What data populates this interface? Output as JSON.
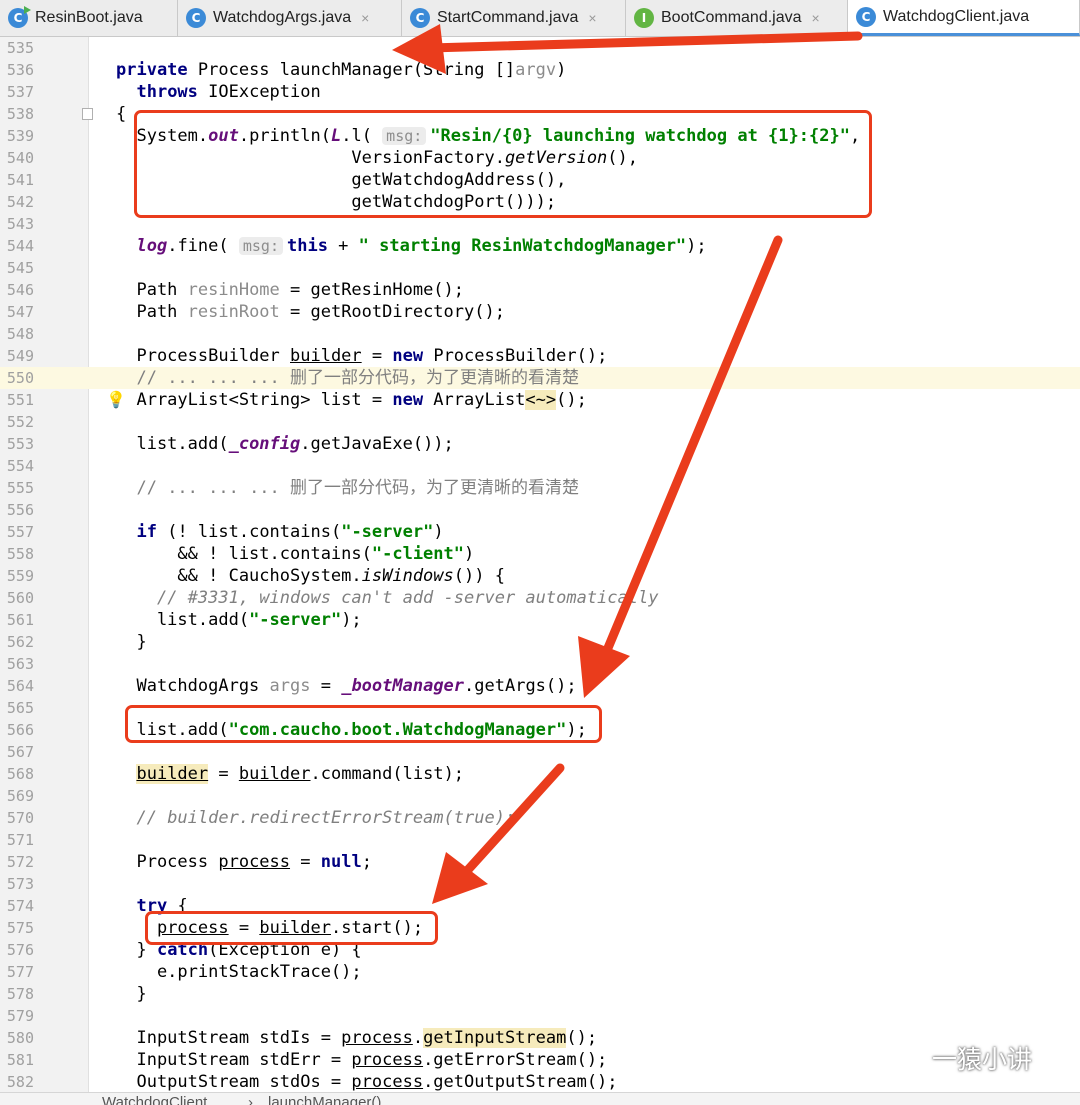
{
  "tabs": [
    {
      "label": "ResinBoot.java",
      "icon": "run-class-icon",
      "close": "×"
    },
    {
      "label": "WatchdogArgs.java",
      "icon": "class-icon",
      "close": "×"
    },
    {
      "label": "StartCommand.java",
      "icon": "class-icon",
      "close": "×"
    },
    {
      "label": "BootCommand.java",
      "icon": "interface-icon",
      "close": "×"
    },
    {
      "label": "WatchdogClient.java",
      "icon": "class-icon",
      "close": "×"
    }
  ],
  "tab_icon_glyphs": {
    "class": "C",
    "interface": "I"
  },
  "editor": {
    "caret_line": "550",
    "lines": [
      {
        "n": "535",
        "t": []
      },
      {
        "n": "536",
        "t": [
          [
            "kw",
            "private "
          ],
          [
            "",
            "Process launchManager(String []"
          ],
          [
            "grey",
            "argv"
          ],
          [
            "",
            ")"
          ]
        ]
      },
      {
        "n": "537",
        "t": [
          [
            "",
            "  "
          ],
          [
            "kw",
            "throws "
          ],
          [
            "",
            "IOException"
          ]
        ]
      },
      {
        "n": "538",
        "t": [
          [
            "",
            "{"
          ]
        ]
      },
      {
        "n": "539",
        "t": [
          [
            "",
            "  System."
          ],
          [
            "fld",
            "out"
          ],
          [
            "",
            ".println("
          ],
          [
            "fld",
            "L"
          ],
          [
            "",
            ".l( "
          ],
          [
            "hint",
            "msg:"
          ],
          [
            "str",
            "\"Resin/{0} launching watchdog at {1}:{2}\""
          ],
          [
            "",
            ","
          ]
        ]
      },
      {
        "n": "540",
        "t": [
          [
            "",
            "                       VersionFactory."
          ],
          [
            "sfn",
            "getVersion"
          ],
          [
            "",
            "(),"
          ]
        ]
      },
      {
        "n": "541",
        "t": [
          [
            "",
            "                       getWatchdogAddress(),"
          ]
        ]
      },
      {
        "n": "542",
        "t": [
          [
            "",
            "                       getWatchdogPort()));"
          ]
        ]
      },
      {
        "n": "543",
        "t": []
      },
      {
        "n": "544",
        "t": [
          [
            "",
            "  "
          ],
          [
            "fld",
            "log"
          ],
          [
            "",
            ".fine( "
          ],
          [
            "hint",
            "msg:"
          ],
          [
            "kw",
            "this"
          ],
          [
            "",
            " + "
          ],
          [
            "str",
            "\" starting ResinWatchdogManager\""
          ],
          [
            "",
            ");"
          ]
        ]
      },
      {
        "n": "545",
        "t": []
      },
      {
        "n": "546",
        "t": [
          [
            "",
            "  Path "
          ],
          [
            "grey",
            "resinHome"
          ],
          [
            "",
            " = getResinHome();"
          ]
        ]
      },
      {
        "n": "547",
        "t": [
          [
            "",
            "  Path "
          ],
          [
            "grey",
            "resinRoot"
          ],
          [
            "",
            " = getRootDirectory();"
          ]
        ]
      },
      {
        "n": "548",
        "t": []
      },
      {
        "n": "549",
        "t": [
          [
            "",
            "  ProcessBuilder "
          ],
          [
            "ul",
            "builder"
          ],
          [
            "",
            " = "
          ],
          [
            "kw",
            "new "
          ],
          [
            "",
            "ProcessBuilder();"
          ]
        ]
      },
      {
        "n": "550",
        "t": [
          [
            "",
            "  "
          ],
          [
            "cmcn",
            "// ... ... ... 删了一部分代码，为了更清晰的看清楚"
          ]
        ]
      },
      {
        "n": "551",
        "t": [
          [
            "",
            "  ArrayList<String> list = "
          ],
          [
            "kw",
            "new "
          ],
          [
            "",
            "ArrayList"
          ],
          [
            "hl",
            "<~>"
          ],
          [
            "",
            "();"
          ]
        ]
      },
      {
        "n": "552",
        "t": []
      },
      {
        "n": "553",
        "t": [
          [
            "",
            "  list.add("
          ],
          [
            "fld",
            "_config"
          ],
          [
            "",
            ".getJavaExe());"
          ]
        ]
      },
      {
        "n": "554",
        "t": []
      },
      {
        "n": "555",
        "t": [
          [
            "",
            "  "
          ],
          [
            "cmcn",
            "// ... ... ... 删了一部分代码，为了更清晰的看清楚"
          ]
        ]
      },
      {
        "n": "556",
        "t": []
      },
      {
        "n": "557",
        "t": [
          [
            "",
            "  "
          ],
          [
            "kw",
            "if "
          ],
          [
            "",
            "(! list.contains("
          ],
          [
            "str",
            "\"-server\""
          ],
          [
            "",
            ")"
          ]
        ]
      },
      {
        "n": "558",
        "t": [
          [
            "",
            "      && ! list.contains("
          ],
          [
            "str",
            "\"-client\""
          ],
          [
            "",
            ")"
          ]
        ]
      },
      {
        "n": "559",
        "t": [
          [
            "",
            "      && ! CauchoSystem."
          ],
          [
            "sfn",
            "isWindows"
          ],
          [
            "",
            "()) {"
          ]
        ]
      },
      {
        "n": "560",
        "t": [
          [
            "",
            "    "
          ],
          [
            "cm",
            "// #3331, windows can't add -server automatically"
          ]
        ]
      },
      {
        "n": "561",
        "t": [
          [
            "",
            "    list.add("
          ],
          [
            "str",
            "\"-server\""
          ],
          [
            "",
            ");"
          ]
        ]
      },
      {
        "n": "562",
        "t": [
          [
            "",
            "  }"
          ]
        ]
      },
      {
        "n": "563",
        "t": []
      },
      {
        "n": "564",
        "t": [
          [
            "",
            "  WatchdogArgs "
          ],
          [
            "grey",
            "args"
          ],
          [
            "",
            " = "
          ],
          [
            "fld",
            "_bootManager"
          ],
          [
            "",
            ".getArgs();"
          ]
        ]
      },
      {
        "n": "565",
        "t": []
      },
      {
        "n": "566",
        "t": [
          [
            "",
            "  list.add("
          ],
          [
            "str",
            "\"com.caucho.boot.WatchdogManager\""
          ],
          [
            "",
            ");"
          ]
        ]
      },
      {
        "n": "567",
        "t": []
      },
      {
        "n": "568",
        "t": [
          [
            "",
            "  "
          ],
          [
            "ul hl",
            "builder"
          ],
          [
            "",
            " = "
          ],
          [
            "ul",
            "builder"
          ],
          [
            "",
            ".command(list);"
          ]
        ]
      },
      {
        "n": "569",
        "t": []
      },
      {
        "n": "570",
        "t": [
          [
            "",
            "  "
          ],
          [
            "cm",
            "// builder.redirectErrorStream(true);"
          ]
        ]
      },
      {
        "n": "571",
        "t": []
      },
      {
        "n": "572",
        "t": [
          [
            "",
            "  Process "
          ],
          [
            "ul",
            "process"
          ],
          [
            "",
            " = "
          ],
          [
            "kw",
            "null"
          ],
          [
            "",
            ";"
          ]
        ]
      },
      {
        "n": "573",
        "t": []
      },
      {
        "n": "574",
        "t": [
          [
            "",
            "  "
          ],
          [
            "kw",
            "try "
          ],
          [
            "",
            "{"
          ]
        ]
      },
      {
        "n": "575",
        "t": [
          [
            "",
            "    "
          ],
          [
            "ul",
            "process"
          ],
          [
            "",
            " = "
          ],
          [
            "ul",
            "builder"
          ],
          [
            "",
            ".start();"
          ]
        ]
      },
      {
        "n": "576",
        "t": [
          [
            "",
            "  } "
          ],
          [
            "kw",
            "catch"
          ],
          [
            "",
            "(Exception e) {"
          ]
        ]
      },
      {
        "n": "577",
        "t": [
          [
            "",
            "    e.printStackTrace();"
          ]
        ]
      },
      {
        "n": "578",
        "t": [
          [
            "",
            "  }"
          ]
        ]
      },
      {
        "n": "579",
        "t": []
      },
      {
        "n": "580",
        "t": [
          [
            "",
            "  InputStream stdIs = "
          ],
          [
            "ul",
            "process"
          ],
          [
            "",
            "."
          ],
          [
            "hl",
            "getInputStream"
          ],
          [
            "",
            "();"
          ]
        ]
      },
      {
        "n": "581",
        "t": [
          [
            "",
            "  InputStream stdErr = "
          ],
          [
            "ul",
            "process"
          ],
          [
            "",
            ".getErrorStream();"
          ]
        ]
      },
      {
        "n": "582",
        "t": [
          [
            "",
            "  OutputStream stdOs = "
          ],
          [
            "ul",
            "process"
          ],
          [
            "",
            ".getOutputStream();"
          ]
        ]
      }
    ]
  },
  "breadcrumb": {
    "class_name": "WatchdogClient",
    "separator": "›",
    "method_name": "launchManager()"
  },
  "watermark": {
    "text": "一猿小讲"
  },
  "colors": {
    "annotation": "#ea3c1c",
    "caret_line": "#fdf9e1",
    "keyword": "#000080",
    "string": "#008000"
  }
}
